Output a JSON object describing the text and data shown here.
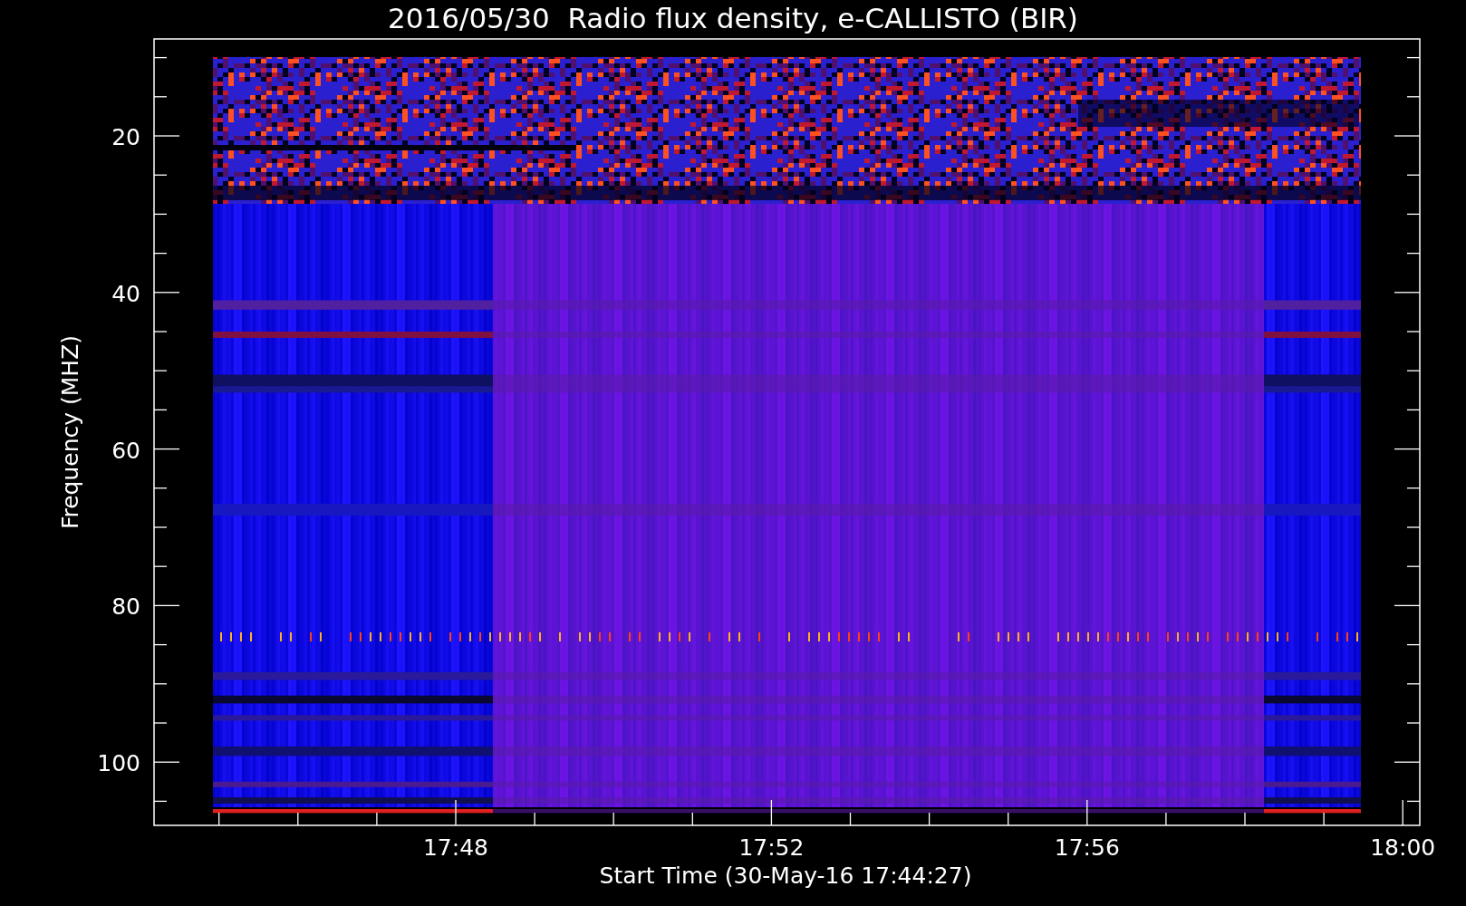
{
  "title": "2016/05/30  Radio flux density, e-CALLISTO (BIR)",
  "y_axis": {
    "label": "Frequency (MHZ)",
    "ticks": [
      "20",
      "40",
      "60",
      "80",
      "100"
    ]
  },
  "x_axis": {
    "label": "Start Time (30-May-16 17:44:27)",
    "ticks": [
      "17:48",
      "17:52",
      "17:56",
      "18:00"
    ]
  }
}
